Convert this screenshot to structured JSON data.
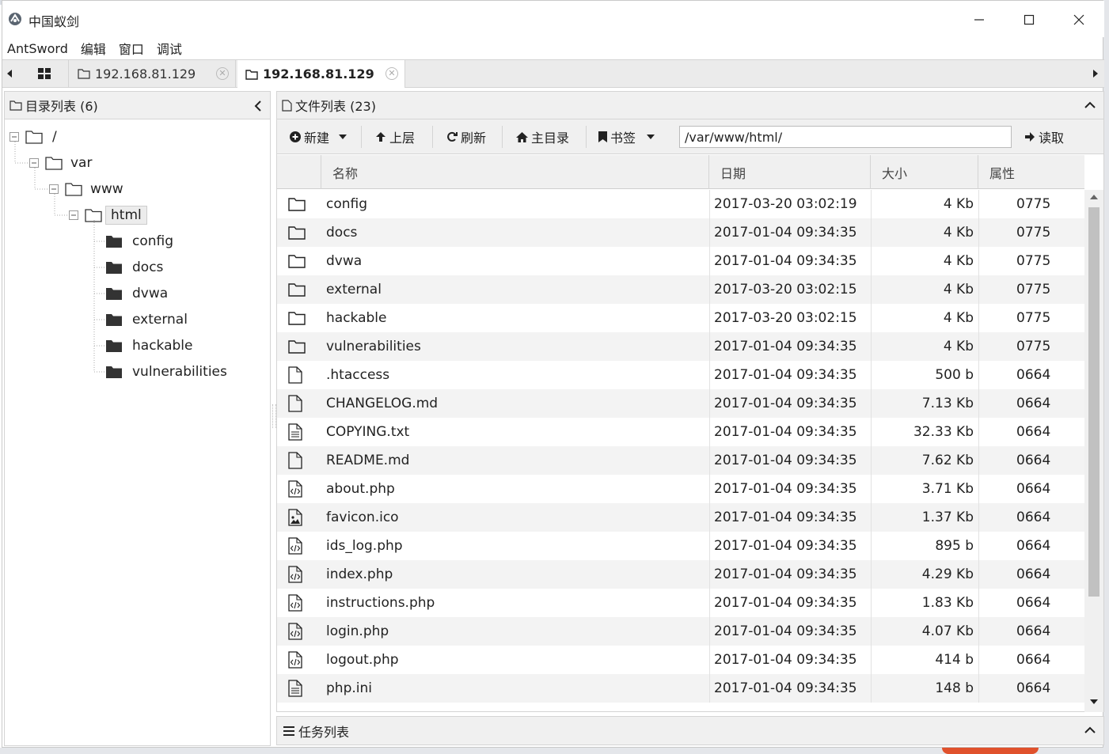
{
  "window": {
    "title": "中国蚁剑"
  },
  "menu": [
    "AntSword",
    "编辑",
    "窗口",
    "调试"
  ],
  "tabs": [
    {
      "label": "192.168.81.129",
      "active": false
    },
    {
      "label": "192.168.81.129",
      "active": true
    }
  ],
  "left_panel": {
    "title": "目录列表 (6)",
    "tree": [
      {
        "label": "/",
        "depth": 0,
        "expanded": true
      },
      {
        "label": "var",
        "depth": 1,
        "expanded": true
      },
      {
        "label": "www",
        "depth": 2,
        "expanded": true
      },
      {
        "label": "html",
        "depth": 3,
        "expanded": true,
        "selected": true
      },
      {
        "label": "config",
        "depth": 4
      },
      {
        "label": "docs",
        "depth": 4
      },
      {
        "label": "dvwa",
        "depth": 4
      },
      {
        "label": "external",
        "depth": 4
      },
      {
        "label": "hackable",
        "depth": 4
      },
      {
        "label": "vulnerabilities",
        "depth": 4
      }
    ]
  },
  "right_panel": {
    "title": "文件列表 (23)",
    "toolbar": {
      "new": "新建",
      "up": "上层",
      "refresh": "刷新",
      "home": "主目录",
      "bookmark": "书签",
      "path": "/var/www/html/",
      "read": "读取"
    },
    "columns": {
      "name": "名称",
      "date": "日期",
      "size": "大小",
      "attr": "属性"
    },
    "files": [
      {
        "icon": "folder-icon",
        "name": "config",
        "date": "2017-03-20 03:02:19",
        "size": "4 Kb",
        "attr": "0775"
      },
      {
        "icon": "folder-icon",
        "name": "docs",
        "date": "2017-01-04 09:34:35",
        "size": "4 Kb",
        "attr": "0775"
      },
      {
        "icon": "folder-icon",
        "name": "dvwa",
        "date": "2017-01-04 09:34:35",
        "size": "4 Kb",
        "attr": "0775"
      },
      {
        "icon": "folder-icon",
        "name": "external",
        "date": "2017-03-20 03:02:15",
        "size": "4 Kb",
        "attr": "0775"
      },
      {
        "icon": "folder-icon",
        "name": "hackable",
        "date": "2017-03-20 03:02:15",
        "size": "4 Kb",
        "attr": "0775"
      },
      {
        "icon": "folder-icon",
        "name": "vulnerabilities",
        "date": "2017-01-04 09:34:35",
        "size": "4 Kb",
        "attr": "0775"
      },
      {
        "icon": "file-icon",
        "name": ".htaccess",
        "date": "2017-01-04 09:34:35",
        "size": "500 b",
        "attr": "0664"
      },
      {
        "icon": "file-icon",
        "name": "CHANGELOG.md",
        "date": "2017-01-04 09:34:35",
        "size": "7.13 Kb",
        "attr": "0664"
      },
      {
        "icon": "text-file-icon",
        "name": "COPYING.txt",
        "date": "2017-01-04 09:34:35",
        "size": "32.33 Kb",
        "attr": "0664"
      },
      {
        "icon": "file-icon",
        "name": "README.md",
        "date": "2017-01-04 09:34:35",
        "size": "7.62 Kb",
        "attr": "0664"
      },
      {
        "icon": "code-file-icon",
        "name": "about.php",
        "date": "2017-01-04 09:34:35",
        "size": "3.71 Kb",
        "attr": "0664"
      },
      {
        "icon": "image-file-icon",
        "name": "favicon.ico",
        "date": "2017-01-04 09:34:35",
        "size": "1.37 Kb",
        "attr": "0664"
      },
      {
        "icon": "code-file-icon",
        "name": "ids_log.php",
        "date": "2017-01-04 09:34:35",
        "size": "895 b",
        "attr": "0664"
      },
      {
        "icon": "code-file-icon",
        "name": "index.php",
        "date": "2017-01-04 09:34:35",
        "size": "4.29 Kb",
        "attr": "0664"
      },
      {
        "icon": "code-file-icon",
        "name": "instructions.php",
        "date": "2017-01-04 09:34:35",
        "size": "1.83 Kb",
        "attr": "0664"
      },
      {
        "icon": "code-file-icon",
        "name": "login.php",
        "date": "2017-01-04 09:34:35",
        "size": "4.07 Kb",
        "attr": "0664"
      },
      {
        "icon": "code-file-icon",
        "name": "logout.php",
        "date": "2017-01-04 09:34:35",
        "size": "414 b",
        "attr": "0664"
      },
      {
        "icon": "text-file-icon",
        "name": "php.ini",
        "date": "2017-01-04 09:34:35",
        "size": "148 b",
        "attr": "0664"
      }
    ]
  },
  "task_panel": {
    "title": "任务列表"
  }
}
